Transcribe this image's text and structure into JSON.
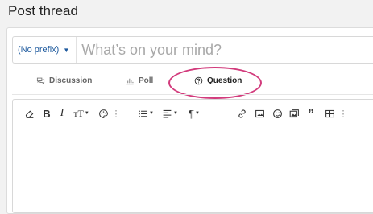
{
  "page": {
    "title": "Post thread"
  },
  "form": {
    "prefix_label": "(No prefix)",
    "title_placeholder": "What’s on your mind?"
  },
  "tabs": [
    {
      "label": "Discussion",
      "icon": "comments-icon",
      "active": false
    },
    {
      "label": "Poll",
      "icon": "bar-chart-icon",
      "active": false
    },
    {
      "label": "Question",
      "icon": "question-circle-icon",
      "active": true
    }
  ],
  "annotation": {
    "color": "#d23b7c"
  },
  "toolbar": {
    "buttons": [
      "eraser-icon",
      "bold-icon",
      "italic-icon",
      "text-size-icon",
      "palette-icon",
      "more-dots-icon",
      "list-icon",
      "align-icon",
      "paragraph-icon",
      "link-icon",
      "image-icon",
      "smile-icon",
      "media-icon",
      "quote-icon",
      "table-icon",
      "more-dots-icon"
    ],
    "bold_glyph": "B",
    "italic_glyph": "I",
    "textsize_glyph": "тT"
  }
}
